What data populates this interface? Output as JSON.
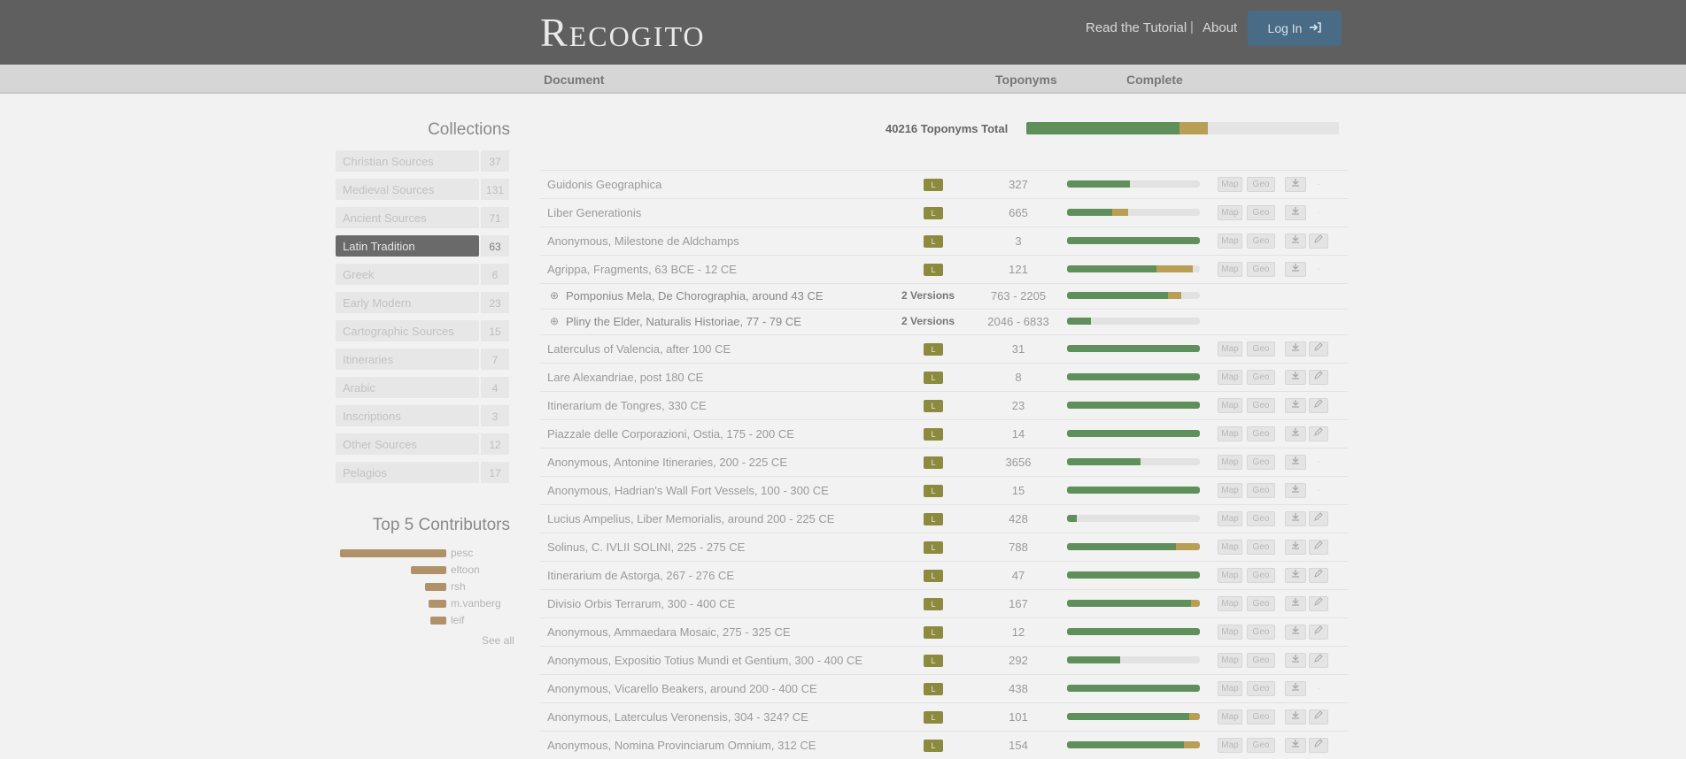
{
  "header": {
    "logo": "Recogito",
    "nav": [
      "Read the Tutorial",
      "About"
    ],
    "nav_separator": "|",
    "login_label": "Log In",
    "login_icon": "sign-in-icon"
  },
  "columns": [
    "Document",
    "Toponyms",
    "Complete"
  ],
  "sidebar": {
    "collections_title": "Collections",
    "collections": [
      {
        "label": "Christian Sources",
        "count": "37",
        "active": false
      },
      {
        "label": "Medieval Sources",
        "count": "131",
        "active": false
      },
      {
        "label": "Ancient Sources",
        "count": "71",
        "active": false
      },
      {
        "label": "Latin Tradition",
        "count": "63",
        "active": true
      },
      {
        "label": "Greek",
        "count": "6",
        "active": false
      },
      {
        "label": "Early Modern",
        "count": "23",
        "active": false
      },
      {
        "label": "Cartographic Sources",
        "count": "15",
        "active": false
      },
      {
        "label": "Itineraries",
        "count": "7",
        "active": false
      },
      {
        "label": "Arabic",
        "count": "4",
        "active": false
      },
      {
        "label": "Inscriptions",
        "count": "3",
        "active": false
      },
      {
        "label": "Other Sources",
        "count": "12",
        "active": false
      },
      {
        "label": "Pelagios",
        "count": "17",
        "active": false
      }
    ],
    "contributors_title": "Top 5 Contributors",
    "contributors": [
      {
        "name": "pesc",
        "share": 1.0
      },
      {
        "name": "eltoon",
        "share": 0.33
      },
      {
        "name": "rsh",
        "share": 0.2
      },
      {
        "name": "m.vanberg",
        "share": 0.17
      },
      {
        "name": "leif",
        "share": 0.15
      }
    ],
    "see_all": "See all"
  },
  "totals": {
    "label": "40216 Toponyms Total",
    "verified_fraction": 0.49,
    "yellow_fraction": 0.09
  },
  "documents": [
    {
      "title": "Guidonis Geographica",
      "badge": "L",
      "toponyms": "327",
      "verified": 0.47,
      "yellow": 0.0,
      "edit": false
    },
    {
      "title": "Liber Generationis",
      "badge": "L",
      "toponyms": "665",
      "verified": 0.34,
      "yellow": 0.12,
      "edit": false
    },
    {
      "title": "Anonymous, Milestone de Aldchamps",
      "badge": "L",
      "toponyms": "3",
      "verified": 1.0,
      "yellow": 0.0,
      "edit": true
    },
    {
      "title": "Agrippa, Fragments, 63 BCE - 12 CE",
      "badge": "L",
      "toponyms": "121",
      "verified": 0.67,
      "yellow": 0.27,
      "edit": false
    },
    {
      "title": "Pomponius Mela, De Chorographia, around 43 CE",
      "sub": true,
      "versions": "2 Versions",
      "toponyms": "763 - 2205",
      "verified": 0.76,
      "yellow": 0.1
    },
    {
      "title": "Pliny the Elder, Naturalis Historiae, 77 - 79 CE",
      "sub": true,
      "versions": "2 Versions",
      "toponyms": "2046 - 6833",
      "verified": 0.18,
      "yellow": 0.0
    },
    {
      "title": "Laterculus of Valencia, after 100 CE",
      "badge": "L",
      "toponyms": "31",
      "verified": 1.0,
      "yellow": 0.0,
      "edit": true
    },
    {
      "title": "Lare Alexandriae, post 180 CE",
      "badge": "L",
      "toponyms": "8",
      "verified": 1.0,
      "yellow": 0.0,
      "edit": true
    },
    {
      "title": "Itinerarium de Tongres, 330 CE",
      "badge": "L",
      "toponyms": "23",
      "verified": 1.0,
      "yellow": 0.0,
      "edit": true
    },
    {
      "title": "Piazzale delle Corporazioni, Ostia, 175 - 200 CE",
      "badge": "L",
      "toponyms": "14",
      "verified": 1.0,
      "yellow": 0.0,
      "edit": true
    },
    {
      "title": "Anonymous, Antonine Itineraries, 200 - 225 CE",
      "badge": "L",
      "toponyms": "3656",
      "verified": 0.55,
      "yellow": 0.0,
      "edit": false
    },
    {
      "title": "Anonymous, Hadrian's Wall Fort Vessels, 100 - 300 CE",
      "badge": "L",
      "toponyms": "15",
      "verified": 1.0,
      "yellow": 0.0,
      "edit": false
    },
    {
      "title": "Lucius Ampelius, Liber Memorialis, around 200 - 225 CE",
      "badge": "L",
      "toponyms": "428",
      "verified": 0.07,
      "yellow": 0.0,
      "edit": true
    },
    {
      "title": "Solinus, C. IVLII SOLINI, 225 - 275 CE",
      "badge": "L",
      "toponyms": "788",
      "verified": 0.82,
      "yellow": 0.18,
      "edit": true
    },
    {
      "title": "Itinerarium de Astorga, 267 - 276 CE",
      "badge": "L",
      "toponyms": "47",
      "verified": 1.0,
      "yellow": 0.0,
      "edit": true
    },
    {
      "title": "Divisio Orbis Terrarum, 300 - 400 CE",
      "badge": "L",
      "toponyms": "167",
      "verified": 0.93,
      "yellow": 0.07,
      "edit": true
    },
    {
      "title": "Anonymous, Ammaedara Mosaic, 275 - 325 CE",
      "badge": "L",
      "toponyms": "12",
      "verified": 1.0,
      "yellow": 0.0,
      "edit": true
    },
    {
      "title": "Anonymous, Expositio Totius Mundi et Gentium, 300 - 400 CE",
      "badge": "L",
      "toponyms": "292",
      "verified": 0.4,
      "yellow": 0.0,
      "edit": true
    },
    {
      "title": "Anonymous, Vicarello Beakers, around 200 - 400 CE",
      "badge": "L",
      "toponyms": "438",
      "verified": 1.0,
      "yellow": 0.0,
      "edit": false
    },
    {
      "title": "Anonymous, Laterculus Veronensis, 304 - 324? CE",
      "badge": "L",
      "toponyms": "101",
      "verified": 0.92,
      "yellow": 0.08,
      "edit": true
    },
    {
      "title": "Anonymous, Nomina Provinciarum Omnium, 312 CE",
      "badge": "L",
      "toponyms": "154",
      "verified": 0.88,
      "yellow": 0.12,
      "edit": true
    }
  ],
  "actions": {
    "map": "Map",
    "geo": "Geo",
    "download_icon": "download-icon",
    "edit_icon": "edit-icon"
  },
  "colors": {
    "header": "#5f5f5f",
    "verified": "#5f8f5a",
    "partial": "#b99e55",
    "badge": "#8b8a3e",
    "active_collection": "#6a6a6a"
  }
}
